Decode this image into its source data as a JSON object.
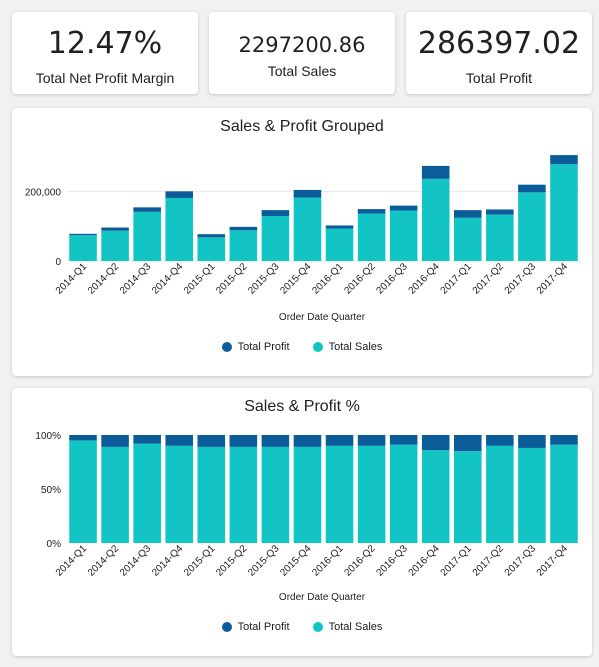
{
  "kpis": {
    "net_profit_margin": {
      "value": "12.47%",
      "label": "Total Net Profit Margin"
    },
    "total_sales": {
      "value": "2297200.86",
      "label": "Total Sales"
    },
    "total_profit": {
      "value": "286397.02",
      "label": "Total Profit"
    }
  },
  "colors": {
    "profit": "#0b5d9a",
    "sales": "#13c4c4",
    "grid": "#e8e8e8",
    "axis": "#202124"
  },
  "legend": {
    "profit": "Total Profit",
    "sales": "Total Sales"
  },
  "chart_data": [
    {
      "type": "bar",
      "title": "Sales & Profit Grouped",
      "xlabel": "Order Date Quarter",
      "ylabel": "",
      "categories": [
        "2014-Q1",
        "2014-Q2",
        "2014-Q3",
        "2014-Q4",
        "2015-Q1",
        "2015-Q2",
        "2015-Q3",
        "2015-Q4",
        "2016-Q1",
        "2016-Q2",
        "2016-Q3",
        "2016-Q4",
        "2017-Q1",
        "2017-Q2",
        "2017-Q3",
        "2017-Q4"
      ],
      "y_ticks": [
        {
          "value": 0,
          "label": "0"
        },
        {
          "value": 200000,
          "label": "200,000"
        }
      ],
      "ylim": [
        0,
        310000
      ],
      "series": [
        {
          "name": "Total Sales",
          "values": [
            74000,
            87000,
            141000,
            181000,
            68000,
            88000,
            129000,
            182000,
            93000,
            136000,
            145000,
            236000,
            124000,
            133000,
            197000,
            278000
          ]
        },
        {
          "name": "Total Profit",
          "values": [
            4000,
            9000,
            13000,
            19000,
            9000,
            10000,
            17000,
            22000,
            9000,
            13000,
            14000,
            37000,
            22000,
            15000,
            22000,
            26000
          ]
        }
      ]
    },
    {
      "type": "bar",
      "title": "Sales & Profit %",
      "xlabel": "Order Date Quarter",
      "ylabel": "",
      "categories": [
        "2014-Q1",
        "2014-Q2",
        "2014-Q3",
        "2014-Q4",
        "2015-Q1",
        "2015-Q2",
        "2015-Q3",
        "2015-Q4",
        "2016-Q1",
        "2016-Q2",
        "2016-Q3",
        "2016-Q4",
        "2017-Q1",
        "2017-Q2",
        "2017-Q3",
        "2017-Q4"
      ],
      "y_ticks": [
        {
          "value": 0,
          "label": "0%"
        },
        {
          "value": 50,
          "label": "50%"
        },
        {
          "value": 100,
          "label": "100%"
        }
      ],
      "ylim": [
        0,
        100
      ],
      "series": [
        {
          "name": "Total Sales",
          "values": [
            95,
            89,
            92,
            90,
            89,
            89,
            89,
            89,
            90,
            90,
            91,
            86,
            85,
            90,
            88,
            91
          ]
        },
        {
          "name": "Total Profit",
          "values": [
            5,
            11,
            8,
            10,
            11,
            11,
            11,
            11,
            10,
            10,
            9,
            14,
            15,
            10,
            12,
            9
          ]
        }
      ]
    }
  ]
}
